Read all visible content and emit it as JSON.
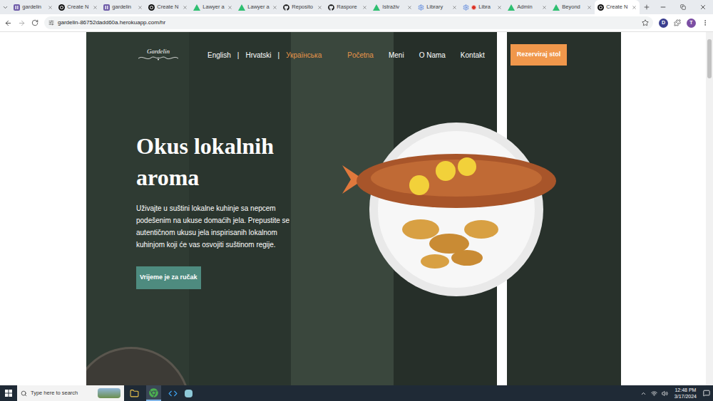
{
  "browser": {
    "tabs": [
      {
        "label": "gardelin",
        "kind": "heroku",
        "selected": false,
        "recording": false
      },
      {
        "label": "Create N",
        "kind": "circle",
        "selected": false,
        "recording": false
      },
      {
        "label": "gardelin",
        "kind": "heroku",
        "selected": false,
        "recording": false
      },
      {
        "label": "Create N",
        "kind": "circle",
        "selected": false,
        "recording": false
      },
      {
        "label": "Lawyer a",
        "kind": "triangle",
        "selected": false,
        "recording": false
      },
      {
        "label": "Lawyer a",
        "kind": "triangle",
        "selected": false,
        "recording": false
      },
      {
        "label": "Reposito",
        "kind": "github",
        "selected": false,
        "recording": false
      },
      {
        "label": "Raspore",
        "kind": "github",
        "selected": false,
        "recording": false
      },
      {
        "label": "Istraživ",
        "kind": "triangle",
        "selected": false,
        "recording": false
      },
      {
        "label": "Library",
        "kind": "gear",
        "selected": false,
        "recording": false
      },
      {
        "label": "Libra",
        "kind": "gear",
        "selected": false,
        "recording": true
      },
      {
        "label": "Admin",
        "kind": "triangle",
        "selected": false,
        "recording": false
      },
      {
        "label": "Beyond",
        "kind": "triangle",
        "selected": false,
        "recording": false
      },
      {
        "label": "Create N",
        "kind": "circle",
        "selected": true,
        "recording": false
      }
    ],
    "url": "gardelin-86752dadd60a.herokuapp.com/hr",
    "extension_badge": "D",
    "profile_initial": "T"
  },
  "page": {
    "logo": "Gardelin",
    "language_separator": "|",
    "languages": [
      {
        "label": "English",
        "hovered": false
      },
      {
        "label": "Hrvatski",
        "hovered": false
      },
      {
        "label": "Українська",
        "hovered": true
      }
    ],
    "nav": [
      {
        "label": "Početna",
        "selected": true
      },
      {
        "label": "Meni",
        "selected": false
      },
      {
        "label": "O Nama",
        "selected": false
      },
      {
        "label": "Kontakt",
        "selected": false
      }
    ],
    "reserve_button": "Rezerviraj stol",
    "hero": {
      "title": "Okus lokalnih aroma",
      "text": "Uživajte u suštini lokalne kuhinje sa nepcem podešenim na ukuse domaćih jela. Prepustite se autentičnom ukusu jela inspirisanih lokalnom kuhinjom koji će vas osvojiti suštinom regije.",
      "button": "Vrijeme je za ručak"
    }
  },
  "taskbar": {
    "search_placeholder": "Type here to search",
    "time": "12:48 PM",
    "date": "3/17/2024"
  }
}
